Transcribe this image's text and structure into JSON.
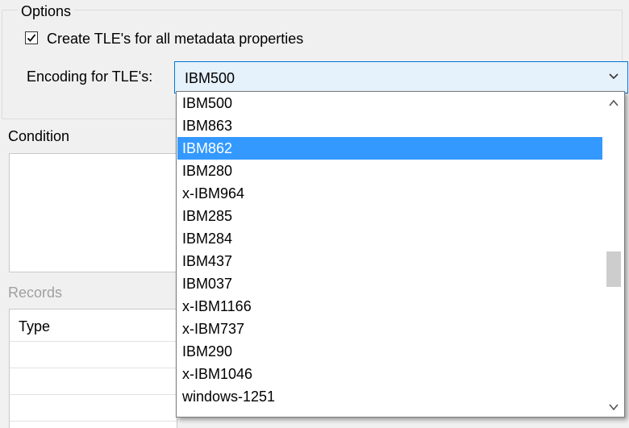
{
  "options": {
    "legend": "Options",
    "create_tle_label": "Create TLE's for all metadata properties",
    "create_tle_checked": true,
    "encoding_label": "Encoding for TLE's:",
    "encoding_value": "IBM500"
  },
  "condition": {
    "label": "Condition"
  },
  "records": {
    "label": "Records",
    "type_header": "Type"
  },
  "dropdown": {
    "items": [
      "IBM500",
      "IBM863",
      "IBM862",
      "IBM280",
      "x-IBM964",
      "IBM285",
      "IBM284",
      "IBM437",
      "IBM037",
      "x-IBM1166",
      "x-IBM737",
      "IBM290",
      "x-IBM1046",
      "windows-1251"
    ],
    "selected": "IBM862"
  },
  "colors": {
    "selection": "#3399ff",
    "combo_border": "#0078d7",
    "combo_background": "#e5f1fb"
  },
  "icons": {
    "checkbox": "checkmark-icon",
    "combo_arrow": "chevron-down-icon",
    "scroll_up": "chevron-up-icon",
    "scroll_down": "chevron-down-icon"
  }
}
